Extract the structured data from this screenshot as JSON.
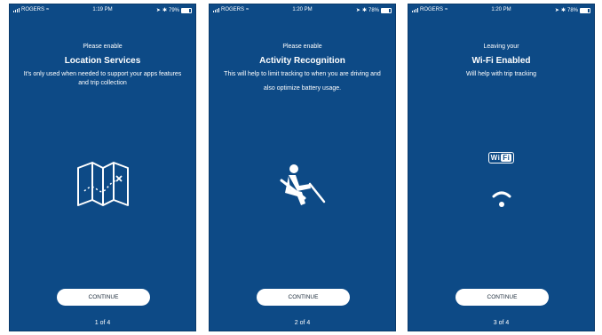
{
  "screens": [
    {
      "status": {
        "carrier": "ROGERS",
        "time": "1:19 PM",
        "battery": "79%"
      },
      "kicker": "Please enable",
      "title": "Location Services",
      "desc": "It's only used when needed to support your apps features and trip collection",
      "icon": "map-route-icon",
      "button": "CONTINUE",
      "pager": "1 of 4"
    },
    {
      "status": {
        "carrier": "ROGERS",
        "time": "1:20 PM",
        "battery": "78%"
      },
      "kicker": "Please enable",
      "title": "Activity Recognition",
      "desc": "This will help to limit tracking to when you are driving and also optimize battery usage.",
      "icon": "seatbelt-driver-icon",
      "button": "CONTINUE",
      "pager": "2 of 4"
    },
    {
      "status": {
        "carrier": "ROGERS",
        "time": "1:20 PM",
        "battery": "78%"
      },
      "kicker": "Leaving your",
      "title": "Wi-Fi Enabled",
      "desc": "Will help with trip tracking",
      "icon": "wifi-icon",
      "wifi_logo": {
        "left": "Wi",
        "right": "Fi"
      },
      "button": "CONTINUE",
      "pager": "3 of 4"
    }
  ],
  "colors": {
    "background": "#0d4a86",
    "button": "#ffffff"
  }
}
